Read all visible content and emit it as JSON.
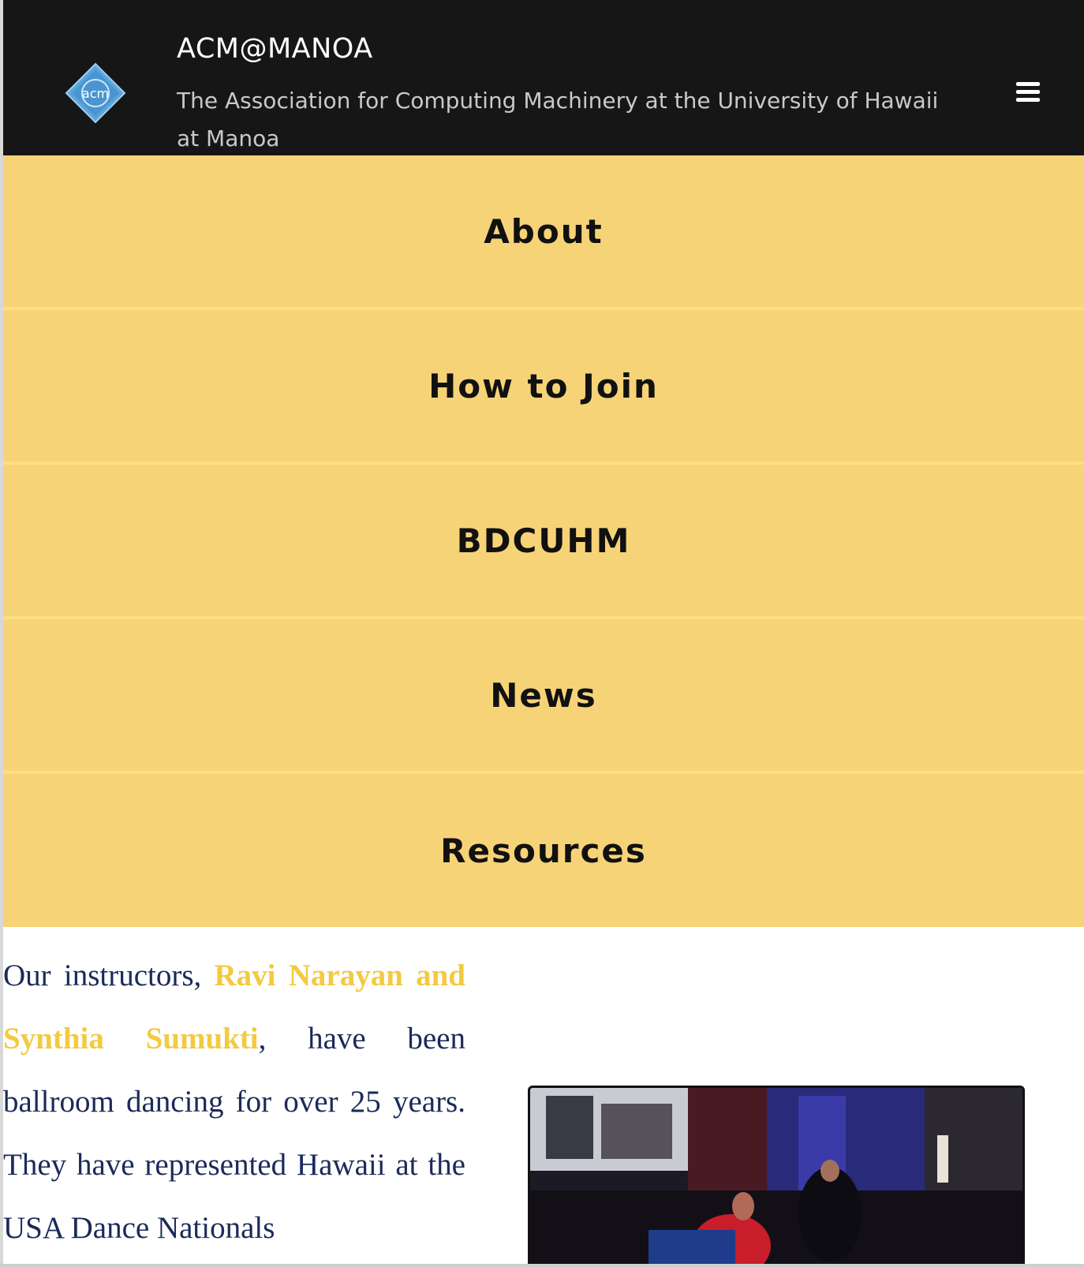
{
  "header": {
    "logo_text": "acm",
    "title": "ACM@MANOA",
    "subtitle": "The Association for Computing Machinery at the University of Hawaii at Manoa"
  },
  "nav": {
    "items": [
      {
        "label": "About"
      },
      {
        "label": "How to Join"
      },
      {
        "label": "BDCUHM"
      },
      {
        "label": "News"
      },
      {
        "label": "Resources"
      }
    ]
  },
  "content": {
    "text_before": "Our instructors, ",
    "instructors": "Ravi Narayan and Synthia Sumukti",
    "text_after": ", have been ballroom dancing for over 25 years. They have represented Hawaii at the USA Dance Nationals"
  },
  "colors": {
    "header_bg": "#161616",
    "nav_bg": "#f7d378",
    "highlight": "#f3ca40",
    "body_text": "#1a2a5a"
  },
  "icons": {
    "logo": "acm-diamond-logo",
    "menu": "hamburger-menu-icon"
  }
}
